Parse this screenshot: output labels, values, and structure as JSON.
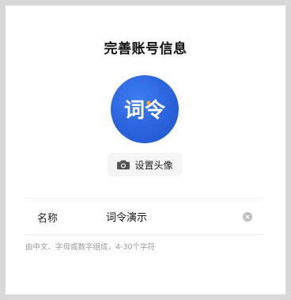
{
  "page": {
    "title": "完善账号信息"
  },
  "avatar": {
    "logo_text": "词令",
    "set_avatar_label": "设置头像",
    "icon": "camera-icon"
  },
  "form": {
    "name_label": "名称",
    "name_value": "词令演示",
    "clear_icon": "clear-icon",
    "hint": "由中文、字母或数字组成，4-30个字符"
  },
  "colors": {
    "avatar_blue": "#2a63dc",
    "logo_orange": "#f5a623",
    "background": "#d9d9d9",
    "card": "#ffffff"
  }
}
